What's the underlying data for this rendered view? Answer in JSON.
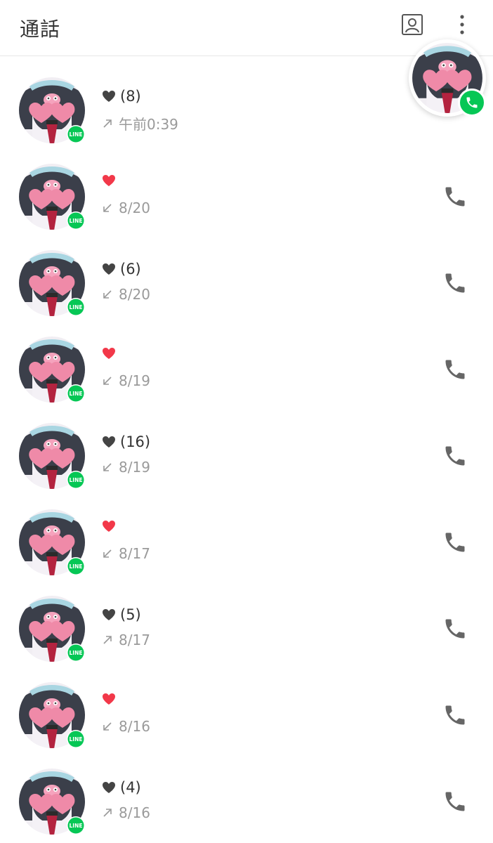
{
  "header": {
    "title": "通話"
  },
  "icons": {
    "contacts": "contacts-icon",
    "more": "more-vertical-icon",
    "call": "phone-icon",
    "badge": "line-app-badge-icon"
  },
  "badge_label": "LINE",
  "colors": {
    "line_green": "#06c755",
    "heart_red": "#f23849",
    "heart_dark": "#444444",
    "icon_gray": "#666666"
  },
  "calls": [
    {
      "name_icon": "dark-heart",
      "count": "(8)",
      "direction": "outgoing",
      "time": "午前0:39"
    },
    {
      "name_icon": "red-heart",
      "count": "",
      "direction": "incoming",
      "time": "8/20"
    },
    {
      "name_icon": "dark-heart",
      "count": "(6)",
      "direction": "incoming",
      "time": "8/20"
    },
    {
      "name_icon": "red-heart",
      "count": "",
      "direction": "incoming",
      "time": "8/19"
    },
    {
      "name_icon": "dark-heart",
      "count": "(16)",
      "direction": "incoming",
      "time": "8/19"
    },
    {
      "name_icon": "red-heart",
      "count": "",
      "direction": "incoming",
      "time": "8/17"
    },
    {
      "name_icon": "dark-heart",
      "count": "(5)",
      "direction": "outgoing",
      "time": "8/17"
    },
    {
      "name_icon": "red-heart",
      "count": "",
      "direction": "incoming",
      "time": "8/16"
    },
    {
      "name_icon": "dark-heart",
      "count": "(4)",
      "direction": "outgoing",
      "time": "8/16"
    }
  ]
}
